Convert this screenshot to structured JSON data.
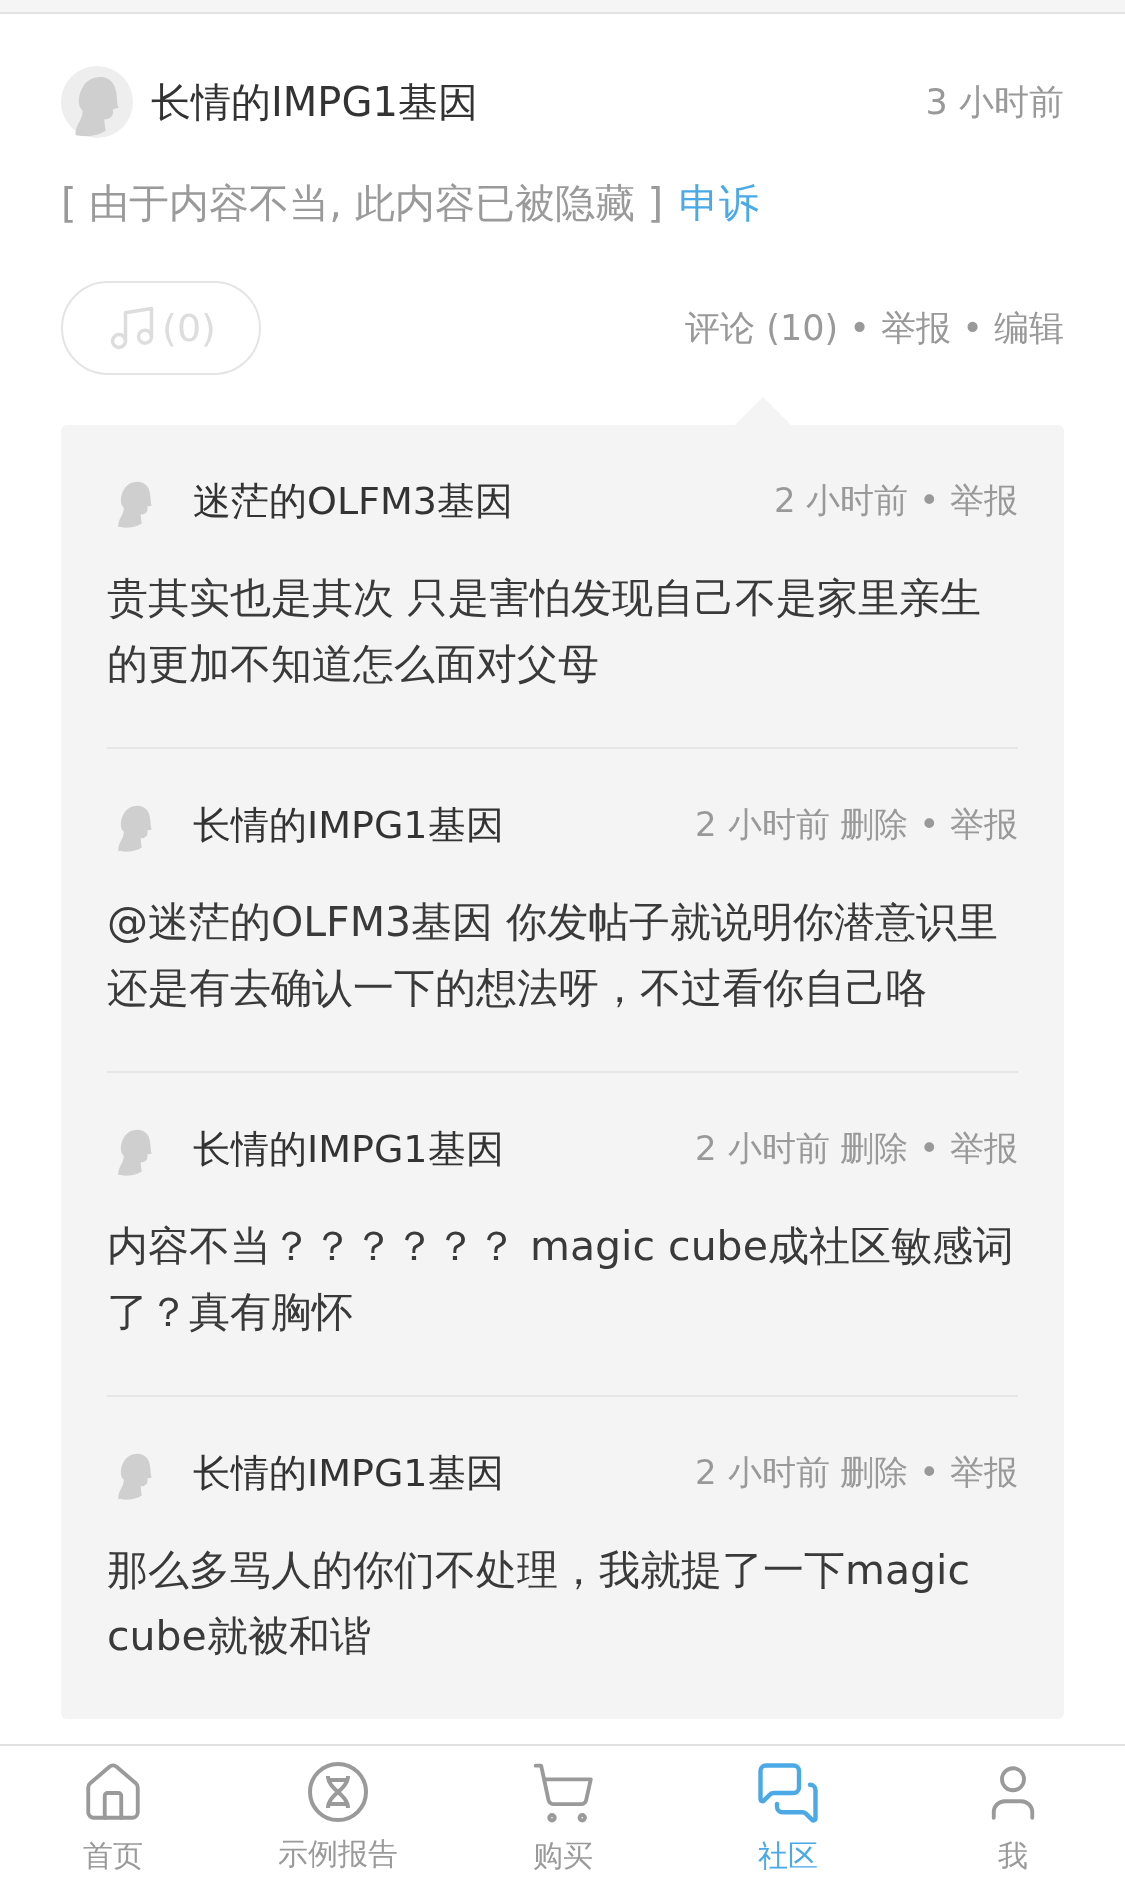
{
  "post": {
    "author": "长情的IMPG1基因",
    "time": "3 小时前",
    "hidden_notice": "[ 由于内容不当, 此内容已被隐藏 ]",
    "appeal": "申诉",
    "like_count": "(0)",
    "actions": "评论 (10) • 举报 • 编辑"
  },
  "comments": [
    {
      "author": "迷茫的OLFM3基因",
      "meta": "2 小时前 • 举报",
      "text": "贵其实也是其次 只是害怕发现自己不是家里亲生的更加不知道怎么面对父母"
    },
    {
      "author": "长情的IMPG1基因",
      "meta": "2 小时前 删除 • 举报",
      "text": "@迷茫的OLFM3基因 你发帖子就说明你潜意识里还是有去确认一下的想法呀，不过看你自己咯"
    },
    {
      "author": "长情的IMPG1基因",
      "meta": "2 小时前 删除 • 举报",
      "text": "内容不当？？？？？？ magic cube成社区敏感词了？真有胸怀"
    },
    {
      "author": "长情的IMPG1基因",
      "meta": "2 小时前 删除 • 举报",
      "text": "那么多骂人的你们不处理，我就提了一下magic cube就被和谐"
    }
  ],
  "nav": [
    {
      "kind": "home",
      "label": "首页",
      "selected": false
    },
    {
      "kind": "dna",
      "label": "示例报告",
      "selected": false
    },
    {
      "kind": "cart",
      "label": "购买",
      "selected": false
    },
    {
      "kind": "chat",
      "label": "社区",
      "selected": true
    },
    {
      "kind": "user",
      "label": "我",
      "selected": false
    }
  ]
}
